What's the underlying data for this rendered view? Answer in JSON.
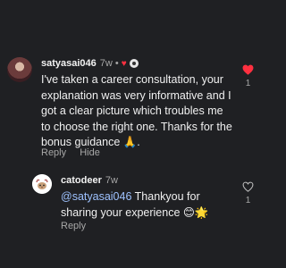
{
  "comment": {
    "username": "satyasai046",
    "time": "7w",
    "dot": "•",
    "liked_by_creator": true,
    "text": "I've taken a career consultation, your explanation was very informative and I got a clear picture which troubles me to choose the right one. Thanks for the bonus guidance 🙏.",
    "actions": {
      "reply": "Reply",
      "hide": "Hide"
    },
    "like_count": "1",
    "like_color": "#ff3040",
    "liked": true
  },
  "reply": {
    "username": "catodeer",
    "time": "7w",
    "mention": "@satyasai046",
    "text": " Thankyou for sharing your experience 😊🌟",
    "actions": {
      "reply": "Reply"
    },
    "like_count": "1",
    "liked": false
  },
  "colors": {
    "background": "#1f2023",
    "mention": "#9ec2ff",
    "muted": "#a7a7a7"
  },
  "icons": {
    "like_filled": "heart-filled-icon",
    "like_outline": "heart-outline-icon",
    "creator_avatar": "creator-avatar-icon"
  }
}
